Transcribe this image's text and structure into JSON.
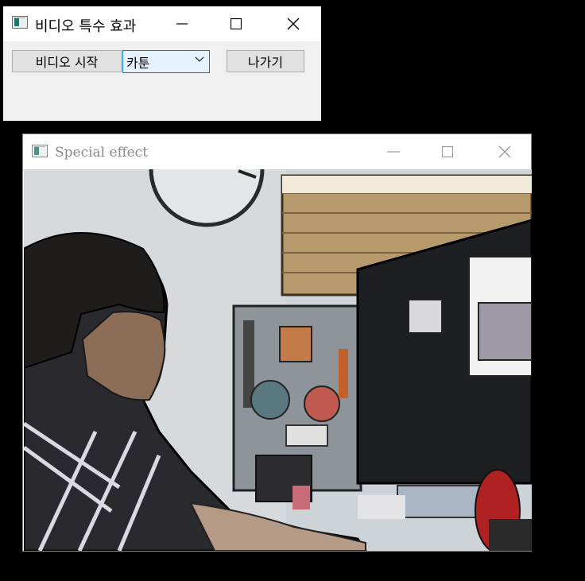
{
  "main_window": {
    "title": "비디오 특수 효과",
    "start_button": "비디오 시작",
    "effect_select": {
      "selected": "카툰"
    },
    "exit_button": "나가기"
  },
  "effect_window": {
    "title": "Special effect"
  },
  "icons": [
    "app-icon",
    "minimize-icon",
    "maximize-icon",
    "close-icon",
    "chevron-down-icon"
  ]
}
